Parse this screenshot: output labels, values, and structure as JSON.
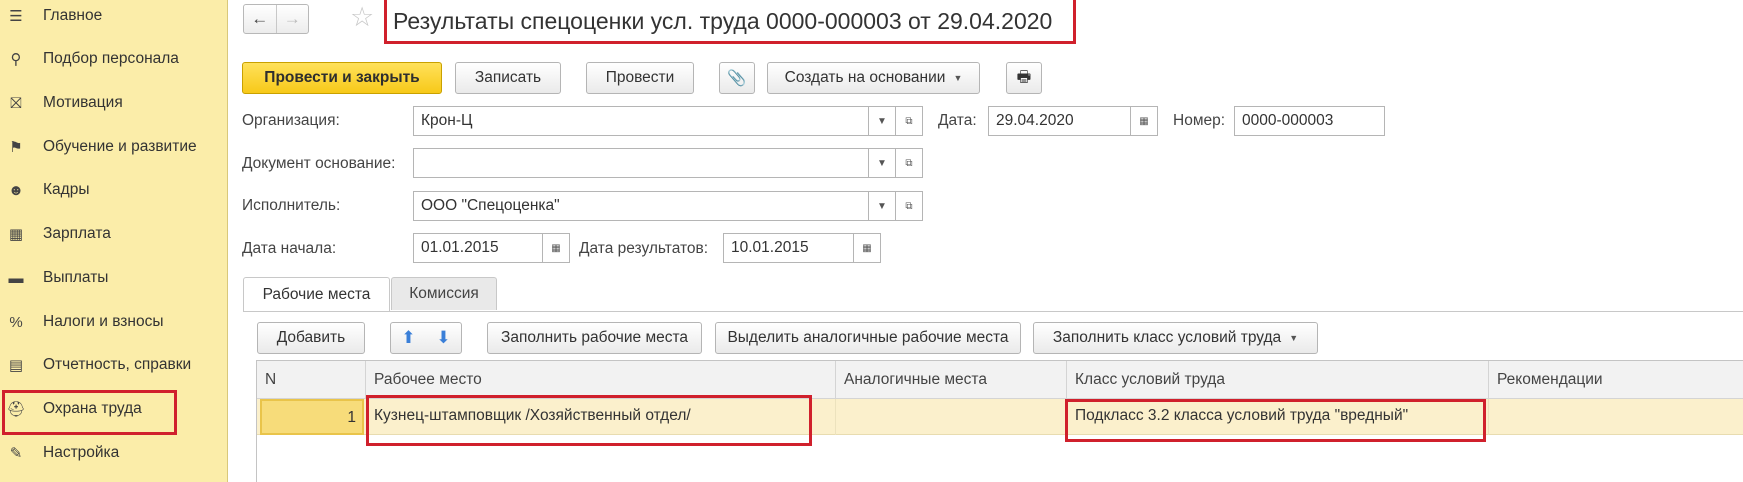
{
  "sidebar": {
    "items": [
      {
        "label": "Главное",
        "icon": "☰"
      },
      {
        "label": "Подбор персонала",
        "icon": "⚲"
      },
      {
        "label": "Мотивация",
        "icon": "⛝"
      },
      {
        "label": "Обучение и развитие",
        "icon": "⚑"
      },
      {
        "label": "Кадры",
        "icon": "☻"
      },
      {
        "label": "Зарплата",
        "icon": "▦"
      },
      {
        "label": "Выплаты",
        "icon": "▬"
      },
      {
        "label": "Налоги и взносы",
        "icon": "%"
      },
      {
        "label": "Отчетность, справки",
        "icon": "▤"
      },
      {
        "label": "Охрана труда",
        "icon": "⛑"
      },
      {
        "label": "Настройка",
        "icon": "✎"
      }
    ]
  },
  "nav": {
    "back": "←",
    "forward": "→",
    "star": "☆"
  },
  "header": {
    "title": "Результаты спецоценки усл. труда 0000-000003 от 29.04.2020"
  },
  "toolbar": {
    "post_close": "Провести и закрыть",
    "save": "Записать",
    "post": "Провести",
    "attach_icon": "📎",
    "create_based": "Создать на основании",
    "print_icon": "🖶"
  },
  "form": {
    "organization_label": "Организация:",
    "organization_value": "Крон-Ц",
    "date_label": "Дата:",
    "date_value": "29.04.2020",
    "number_label": "Номер:",
    "number_value": "0000-000003",
    "basis_label": "Документ основание:",
    "basis_value": "",
    "executor_label": "Исполнитель:",
    "executor_value": "ООО \"Спецоценка\"",
    "start_label": "Дата начала:",
    "start_value": "01.01.2015",
    "results_label": "Дата результатов:",
    "results_value": "10.01.2015"
  },
  "tabs": {
    "workplaces": "Рабочие места",
    "commission": "Комиссия"
  },
  "table_toolbar": {
    "add": "Добавить",
    "fill_workplaces": "Заполнить рабочие места",
    "select_similar": "Выделить аналогичные рабочие места",
    "fill_class": "Заполнить класс условий труда"
  },
  "table": {
    "columns": [
      "N",
      "Рабочее место",
      "Аналогичные места",
      "Класс условий труда",
      "Рекомендации"
    ],
    "rows": [
      {
        "n": "1",
        "workplace": "Кузнец-штамповщик /Хозяйственный отдел/",
        "similar": "",
        "class": "Подкласс 3.2 класса условий труда \"вредный\"",
        "recommendations": ""
      }
    ]
  },
  "colors": {
    "sidebar_bg": "#fbeda9",
    "accent_yellow": "#f7c919",
    "highlight_red": "#d0202c"
  }
}
